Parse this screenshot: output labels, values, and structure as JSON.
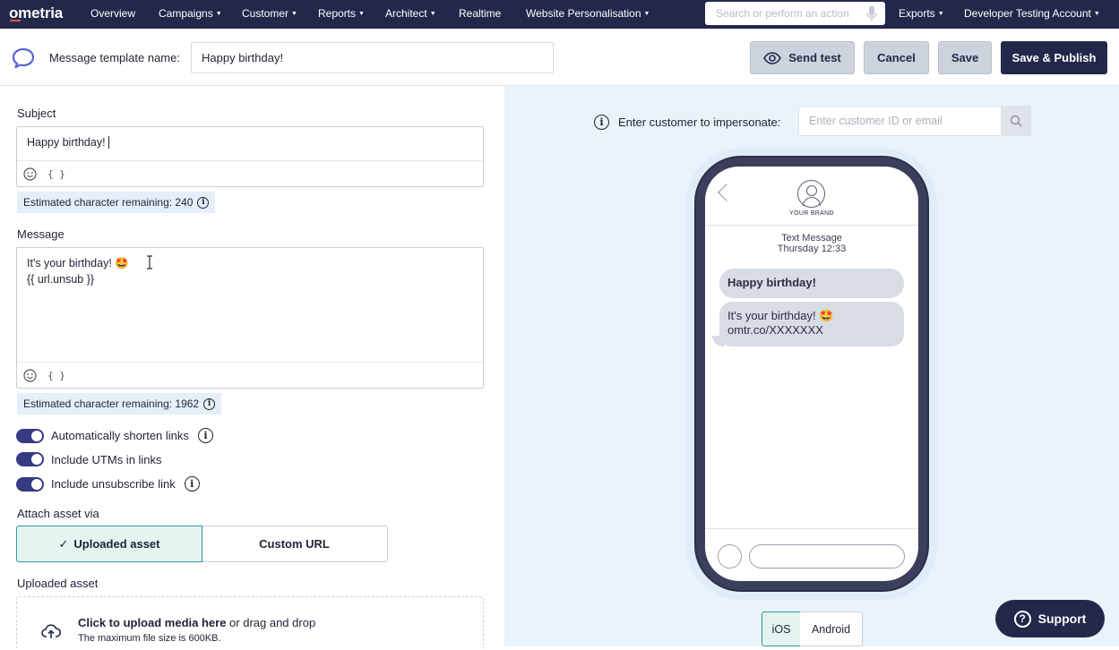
{
  "nav": {
    "logo": "ometria",
    "items": [
      {
        "label": "Overview",
        "caret": false
      },
      {
        "label": "Campaigns",
        "caret": true
      },
      {
        "label": "Customer",
        "caret": true
      },
      {
        "label": "Reports",
        "caret": true
      },
      {
        "label": "Architect",
        "caret": true
      },
      {
        "label": "Realtime",
        "caret": false
      },
      {
        "label": "Website Personalisation",
        "caret": true
      }
    ],
    "search_placeholder": "Search or perform an action",
    "exports": "Exports",
    "account": "Developer Testing Account"
  },
  "toolbar": {
    "template_name_label": "Message template name:",
    "template_name_value": "Happy birthday!",
    "send_test": "Send test",
    "cancel": "Cancel",
    "save": "Save",
    "save_publish": "Save & Publish"
  },
  "editor": {
    "subject_label": "Subject",
    "subject_value": "Happy birthday!",
    "subject_remaining": "Estimated character remaining: 240",
    "message_label": "Message",
    "message_line1": "It's your birthday! 🤩",
    "message_line2": "{{ url.unsub }}",
    "message_remaining": "Estimated character remaining: 1962",
    "variable_icon_text": "{ }",
    "toggles": [
      {
        "label": "Automatically shorten links",
        "on": true,
        "info": true
      },
      {
        "label": "Include UTMs in links",
        "on": true,
        "info": false
      },
      {
        "label": "Include unsubscribe link",
        "on": true,
        "info": true
      }
    ],
    "attach_label": "Attach asset via",
    "attach_options": [
      "Uploaded asset",
      "Custom URL"
    ],
    "attach_selected": "Uploaded asset",
    "uploaded_label": "Uploaded asset",
    "upload_cta": "Click to upload media here",
    "upload_cta_rest": " or drag and drop",
    "upload_hint": "The maximum file size is 600KB."
  },
  "preview": {
    "impersonate_label": "Enter customer to impersonate:",
    "impersonate_placeholder": "Enter customer ID or email",
    "brand": "YOUR BRAND",
    "meta_line1": "Text Message",
    "meta_line2": "Thursday 12:33",
    "bubble1": "Happy birthday!",
    "bubble2_line1": "It's your birthday! 🤩",
    "bubble2_line2": "omtr.co/XXXXXXX",
    "os_tabs": [
      "iOS",
      "Android"
    ],
    "os_selected": "iOS"
  },
  "support": {
    "label": "Support"
  },
  "colors": {
    "nav": "#23284b",
    "accent_toggle": "#353b82",
    "selected_green": "#2a9d8f",
    "preview_bg": "#e9f3fb"
  }
}
